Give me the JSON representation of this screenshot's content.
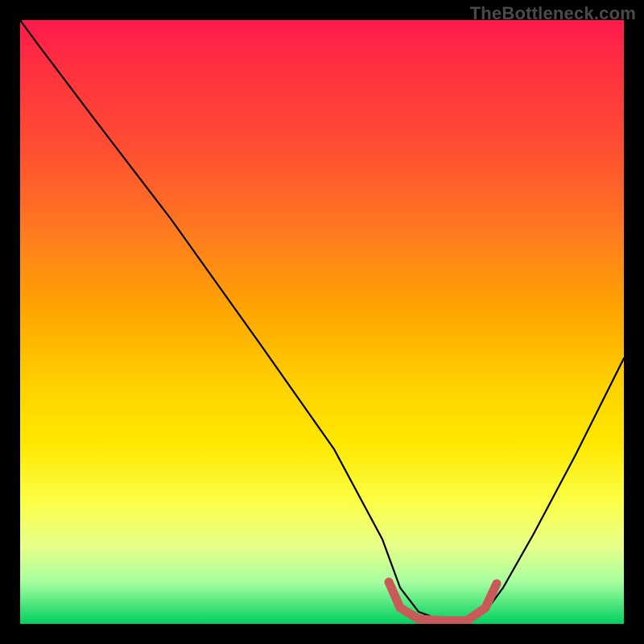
{
  "watermark": "TheBottleneck.com",
  "chart_data": {
    "type": "line",
    "title": "",
    "xlabel": "",
    "ylabel": "",
    "xlim": [
      0,
      100
    ],
    "ylim": [
      0,
      100
    ],
    "grid": false,
    "series": [
      {
        "name": "primary-curve",
        "color": "#000000",
        "x": [
          0,
          3,
          12,
          25,
          40,
          52,
          60,
          63,
          66,
          70,
          74,
          77,
          80,
          85,
          92,
          100
        ],
        "values": [
          100,
          96,
          84,
          67,
          46,
          29,
          14,
          6,
          2,
          0.5,
          0.5,
          2,
          6,
          15,
          28,
          44
        ]
      },
      {
        "name": "optimal-segment",
        "color": "#c85a5a",
        "x": [
          61,
          63,
          66,
          70,
          74,
          77,
          79
        ],
        "values": [
          7,
          2,
          0.5,
          0.5,
          0.5,
          2,
          6
        ]
      }
    ],
    "annotations": []
  }
}
